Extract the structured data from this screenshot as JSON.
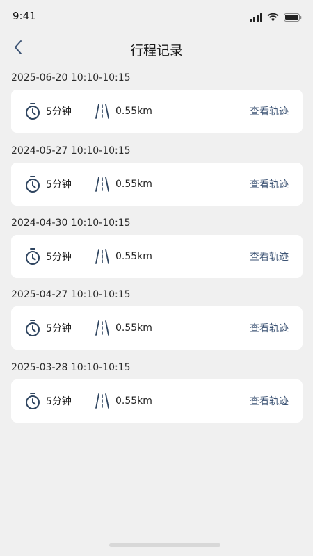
{
  "status_bar": {
    "time": "9:41"
  },
  "nav": {
    "title": "行程记录"
  },
  "records": [
    {
      "date": "2025-06-20 10:10-10:15",
      "duration": "5分钟",
      "distance": "0.55km",
      "action": "查看轨迹"
    },
    {
      "date": "2024-05-27 10:10-10:15",
      "duration": "5分钟",
      "distance": "0.55km",
      "action": "查看轨迹"
    },
    {
      "date": "2024-04-30 10:10-10:15",
      "duration": "5分钟",
      "distance": "0.55km",
      "action": "查看轨迹"
    },
    {
      "date": "2025-04-27 10:10-10:15",
      "duration": "5分钟",
      "distance": "0.55km",
      "action": "查看轨迹"
    },
    {
      "date": "2025-03-28 10:10-10:15",
      "duration": "5分钟",
      "distance": "0.55km",
      "action": "查看轨迹"
    }
  ],
  "colors": {
    "accent": "#3b5273",
    "icon": "#2f4560",
    "background": "#f0f0f0",
    "card": "#ffffff"
  }
}
